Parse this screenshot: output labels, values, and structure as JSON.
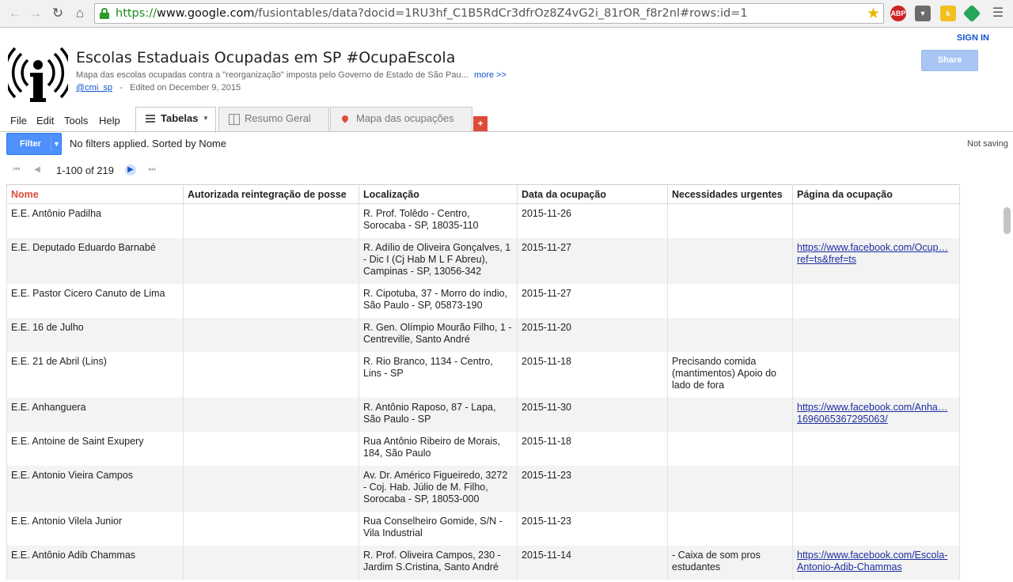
{
  "browser": {
    "url_scheme": "https://",
    "url_host": "www.google.com",
    "url_rest": "/fusiontables/data?docid=1RU3hf_C1B5RdCr3dfrOz8Z4vG2i_81rOR_f8r2nl#rows:id=1",
    "extensions": [
      "ABP",
      "k"
    ]
  },
  "header": {
    "title": "Escolas Estaduais Ocupadas em SP #OcupaEscola",
    "description": "Mapa das escolas ocupadas contra a \"reorganização\" imposta pelo Governo de Estado de São Pau...",
    "more_link": "more >>",
    "owner": "@cmi_sp",
    "separator": "-",
    "edited": "Edited on December 9, 2015",
    "signin": "SIGN IN",
    "share": "Share"
  },
  "menu": [
    "File",
    "Edit",
    "Tools",
    "Help"
  ],
  "tabs": [
    {
      "label": "Tabelas",
      "icon": "list-icon",
      "active": true
    },
    {
      "label": "Resumo Geral",
      "icon": "summary-icon",
      "active": false
    },
    {
      "label": "Mapa das ocupações",
      "icon": "map-pin-icon",
      "active": false
    }
  ],
  "add_tab": "+",
  "toolbar": {
    "filter_label": "Filter",
    "filter_status": "No filters applied. Sorted by Nome",
    "saving_status": "Not saving"
  },
  "pager": {
    "range": "1-100 of 219"
  },
  "colors": {
    "accent_blue": "#4d90fe",
    "link": "#1155cc",
    "sorted_header": "#dd4b39",
    "add_tab": "#dd4b39"
  },
  "table": {
    "columns": [
      "Nome",
      "Autorizada reintegração de posse",
      "Localização",
      "Data da ocupação",
      "Necessidades urgentes",
      "Página da ocupação"
    ],
    "sorted_column": "Nome",
    "rows": [
      {
        "nome": "E.E. Antônio Padilha",
        "reintegracao": "",
        "localizacao": "R. Prof. Tolêdo - Centro, Sorocaba - SP, 18035-110",
        "data": "2015-11-26",
        "necessidades": "",
        "pagina": ""
      },
      {
        "nome": "E.E. Deputado Eduardo Barnabé",
        "reintegracao": "",
        "localizacao": "R. Adílio de Oliveira Gonçalves, 1 - Dic I (Cj Hab M L F Abreu), Campinas - SP, 13056-342",
        "data": "2015-11-27",
        "necessidades": "",
        "pagina": "https://www.facebook.com/Ocup…\nref=ts&fref=ts"
      },
      {
        "nome": "E.E. Pastor Cicero Canuto de Lima",
        "reintegracao": "",
        "localizacao": "R. Cipotuba, 37 - Morro do índio, São Paulo - SP, 05873-190",
        "data": "2015-11-27",
        "necessidades": "",
        "pagina": ""
      },
      {
        "nome": "E.E. 16 de Julho",
        "reintegracao": "",
        "localizacao": "R. Gen. Olímpio Mourão Filho, 1 - Centreville, Santo André",
        "data": "2015-11-20",
        "necessidades": "",
        "pagina": ""
      },
      {
        "nome": "E.E. 21 de Abril (Lins)",
        "reintegracao": "",
        "localizacao": "R. Rio Branco, 1134 - Centro, Lins - SP",
        "data": "2015-11-18",
        "necessidades": "Precisando comida (mantimentos) Apoio do lado de fora",
        "pagina": ""
      },
      {
        "nome": "E.E. Anhanguera",
        "reintegracao": "",
        "localizacao": "R. Antônio Raposo, 87 - Lapa, São Paulo - SP",
        "data": "2015-11-30",
        "necessidades": "",
        "pagina": "https://www.facebook.com/Anha…\n1696065367295063/"
      },
      {
        "nome": "E.E. Antoine de Saint Exupery",
        "reintegracao": "",
        "localizacao": "Rua Antônio Ribeiro de Morais, 184, São Paulo",
        "data": "2015-11-18",
        "necessidades": "",
        "pagina": ""
      },
      {
        "nome": "E.E. Antonio Vieira Campos",
        "reintegracao": "",
        "localizacao": "Av. Dr. Américo Figueiredo, 3272 - Coj. Hab. Júlio de M. Filho, Sorocaba - SP, 18053-000",
        "data": "2015-11-23",
        "necessidades": "",
        "pagina": ""
      },
      {
        "nome": "E.E. Antonio Vilela Junior",
        "reintegracao": "",
        "localizacao": "Rua Conselheiro Gomide, S/N - Vila Industrial",
        "data": "2015-11-23",
        "necessidades": "",
        "pagina": ""
      },
      {
        "nome": "E.E. Antônio Adib Chammas",
        "reintegracao": "",
        "localizacao": "R. Prof. Oliveira Campos, 230 - Jardim S.Cristina, Santo André",
        "data": "2015-11-14",
        "necessidades": "- Caixa de som pros estudantes",
        "pagina": "https://www.facebook.com/Escola-\nAntonio-Adib-Chammas"
      }
    ]
  }
}
